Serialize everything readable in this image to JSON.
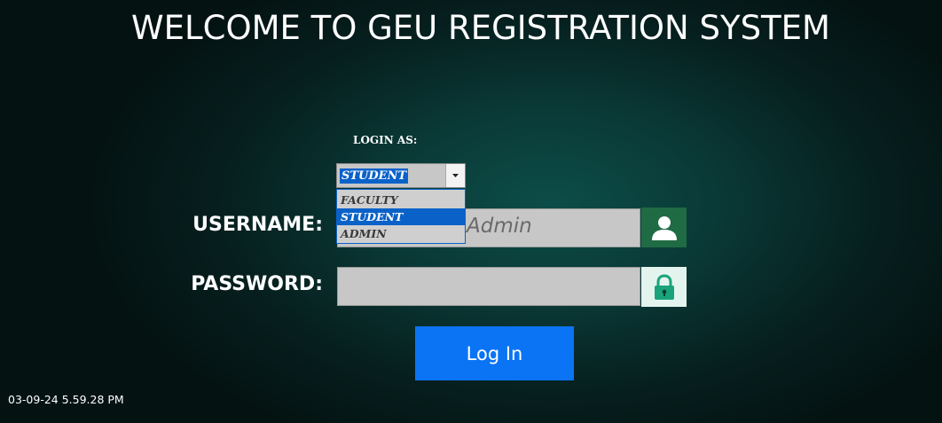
{
  "title": "WELCOME TO GEU REGISTRATION SYSTEM",
  "login_as": {
    "label": "LOGIN AS:",
    "selected": "STUDENT",
    "options": [
      "FACULTY",
      "STUDENT",
      "ADMIN"
    ],
    "selected_index": 1
  },
  "username": {
    "label": "USERNAME:",
    "placeholder": "Admin",
    "icon": "user-icon"
  },
  "password": {
    "label": "PASSWORD:",
    "value": "",
    "icon": "lock-icon"
  },
  "login_button": {
    "label": "Log In"
  },
  "timestamp": "03-09-24 5.59.28 PM",
  "colors": {
    "button": "#0a74f4",
    "selection": "#0a62c9",
    "user_icon_bg": "#1f6b44",
    "lock_icon_bg": "#e3f4ee",
    "lock_icon": "#1aa37a"
  }
}
